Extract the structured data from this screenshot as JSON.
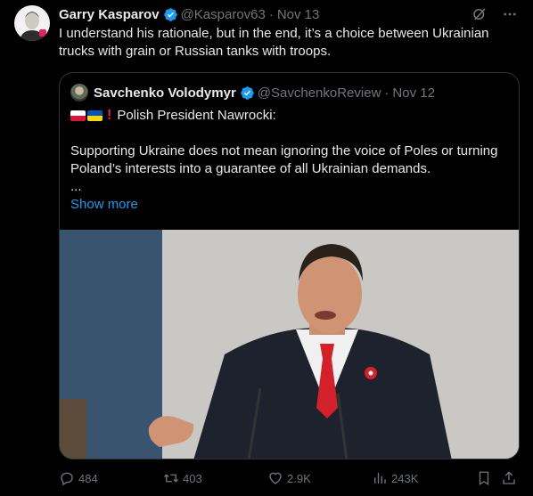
{
  "author": {
    "name": "Garry Kasparov",
    "handle": "@Kasparov63",
    "date": "Nov 13",
    "separator": "·"
  },
  "tweet_text": "I understand his rationale, but in the end, it’s a choice between Ukrainian trucks with grain or Russian tanks with troops.",
  "quoted": {
    "name": "Savchenko Volodymyr",
    "handle": "@SavchenkoReview",
    "date": "Nov 12",
    "separator": "·",
    "flags": [
      "flag-poland",
      "flag-ukraine",
      "red-exclamation"
    ],
    "line1": "Polish President Nawrocki:",
    "line2": "Supporting Ukraine does not mean ignoring the voice of Poles or turning Poland’s interests into a guarantee of all Ukrainian demands.",
    "line3": "...",
    "show_more": "Show more"
  },
  "actions": {
    "replies": "484",
    "retweets": "403",
    "likes": "2.9K",
    "views": "243K"
  },
  "colors": {
    "background": "#000000",
    "text": "#e7e9ea",
    "secondary": "#71767b",
    "link": "#1d9bf0",
    "verified": "#1d9bf0",
    "border": "#2f3336"
  }
}
